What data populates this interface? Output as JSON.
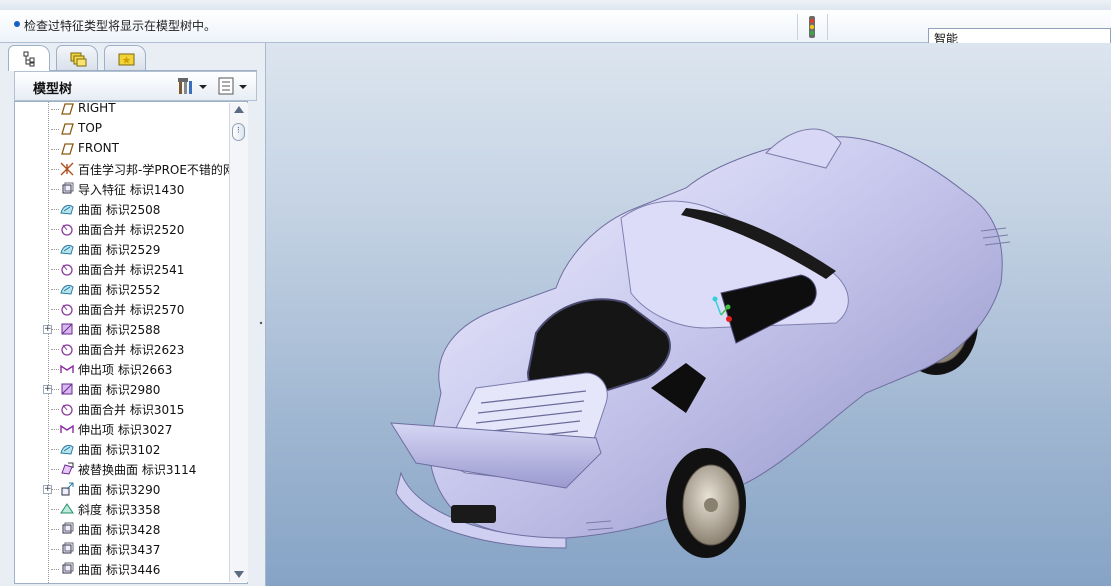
{
  "message_bar": {
    "message": "检查过特征类型将显示在模型树中。",
    "filter_value": "智能"
  },
  "model_tree": {
    "title": "模型树",
    "items": [
      {
        "label": "RIGHT",
        "icon": "datum-plane-icon",
        "expandable": false
      },
      {
        "label": "TOP",
        "icon": "datum-plane-icon",
        "expandable": false
      },
      {
        "label": "FRONT",
        "icon": "datum-plane-icon",
        "expandable": false
      },
      {
        "label": "百佳学习邦-学PROE不错的网",
        "icon": "coordinate-system-icon",
        "expandable": false
      },
      {
        "label": "导入特征 标识1430",
        "icon": "import-feature-icon",
        "expandable": false
      },
      {
        "label": "曲面 标识2508",
        "icon": "surface-icon",
        "expandable": false
      },
      {
        "label": "曲面合并 标识2520",
        "icon": "surface-merge-icon",
        "expandable": false
      },
      {
        "label": "曲面 标识2529",
        "icon": "surface-icon",
        "expandable": false
      },
      {
        "label": "曲面合并 标识2541",
        "icon": "surface-merge-icon",
        "expandable": false
      },
      {
        "label": "曲面 标识2552",
        "icon": "surface-icon",
        "expandable": false
      },
      {
        "label": "曲面合并 标识2570",
        "icon": "surface-merge-icon",
        "expandable": false
      },
      {
        "label": "曲面 标识2588",
        "icon": "fill-surface-icon",
        "expandable": true
      },
      {
        "label": "曲面合并 标识2623",
        "icon": "surface-merge-icon",
        "expandable": false
      },
      {
        "label": "伸出项 标识2663",
        "icon": "extrude-icon",
        "expandable": false
      },
      {
        "label": "曲面 标识2980",
        "icon": "fill-surface-icon",
        "expandable": true
      },
      {
        "label": "曲面合并 标识3015",
        "icon": "surface-merge-icon",
        "expandable": false
      },
      {
        "label": "伸出项 标识3027",
        "icon": "extrude-icon",
        "expandable": false
      },
      {
        "label": "曲面 标识3102",
        "icon": "surface-icon",
        "expandable": false
      },
      {
        "label": "被替换曲面 标识3114",
        "icon": "replace-surface-icon",
        "expandable": false
      },
      {
        "label": "曲面 标识3290",
        "icon": "offset-surface-icon",
        "expandable": true
      },
      {
        "label": "斜度 标识3358",
        "icon": "draft-icon",
        "expandable": false
      },
      {
        "label": "曲面 标识3428",
        "icon": "import-feature-icon",
        "expandable": false
      },
      {
        "label": "曲面 标识3437",
        "icon": "import-feature-icon",
        "expandable": false
      },
      {
        "label": "曲面 标识3446",
        "icon": "import-feature-icon",
        "expandable": false
      }
    ]
  }
}
